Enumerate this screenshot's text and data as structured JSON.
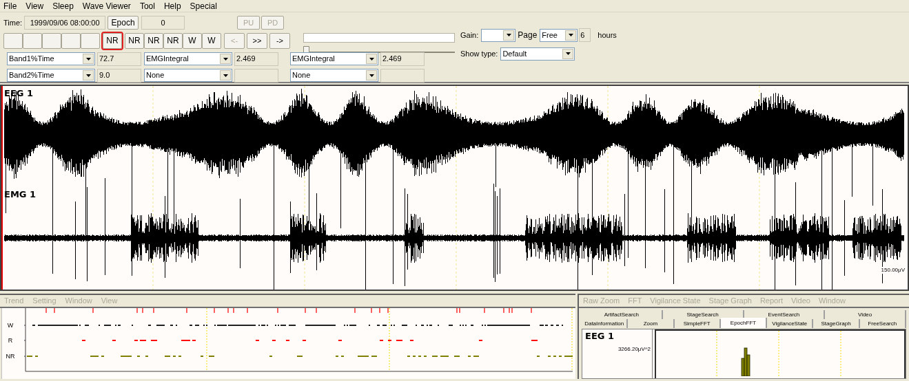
{
  "menu": [
    {
      "label": "File"
    },
    {
      "label": "View"
    },
    {
      "label": "Sleep"
    },
    {
      "label": "Wave Viewer"
    },
    {
      "label": "Tool"
    },
    {
      "label": "Help"
    },
    {
      "label": "Special"
    }
  ],
  "toolbar": {
    "time_label": "Time:",
    "time_value": "1999/09/06 08:00:00",
    "epoch_button": "Epoch",
    "epoch_value": "0",
    "page_buttons": [
      {
        "label": "PU",
        "disabled": true
      },
      {
        "label": "PD",
        "disabled": true
      }
    ],
    "stage_buttons": [
      {
        "kind": "blank",
        "selected": false
      },
      {
        "kind": "blank",
        "selected": false
      },
      {
        "kind": "blank",
        "selected": false
      },
      {
        "kind": "blank",
        "selected": false
      },
      {
        "kind": "blank",
        "selected": false
      },
      {
        "kind": "stage",
        "label": "NR",
        "selected": true
      },
      {
        "kind": "stage",
        "label": "NR",
        "selected": false
      },
      {
        "kind": "stage",
        "label": "NR",
        "selected": false
      },
      {
        "kind": "stage",
        "label": "NR",
        "selected": false
      },
      {
        "kind": "stage",
        "label": "W",
        "selected": false
      },
      {
        "kind": "stage",
        "label": "W",
        "selected": false
      }
    ],
    "nav_buttons": [
      {
        "label": "<-",
        "disabled": true
      },
      {
        "label": ">>",
        "disabled": false
      },
      {
        "label": "->",
        "disabled": false
      }
    ],
    "position_slider": {
      "level": 0
    },
    "gain_label": "Gain:",
    "page_label": "Page",
    "page_value": "Free",
    "hours_value": "6",
    "hours_label": "hours",
    "show_type_label": "Show type:",
    "show_type_value": "Default"
  },
  "measures": [
    [
      {
        "select": "Band1%Time",
        "value": "72.7"
      },
      {
        "select": "EMGIntegral",
        "value": "2.469"
      },
      {
        "select": "EMGIntegral",
        "value": "2.469"
      }
    ],
    [
      {
        "select": "Band2%Time",
        "value": "9.0"
      },
      {
        "select": "None"
      },
      {
        "select": "None"
      }
    ]
  ],
  "wave_viewer": {
    "channels": [
      {
        "name": "EEG 1"
      },
      {
        "name": "EMG 1",
        "scale": "150.00μV"
      }
    ]
  },
  "trend_panel": {
    "menu": [
      {
        "label": "Trend",
        "disabled": true
      },
      {
        "label": "Setting",
        "disabled": true
      },
      {
        "label": "Window",
        "disabled": true
      },
      {
        "label": "View",
        "disabled": true
      }
    ],
    "stages": [
      "W",
      "R",
      "NR"
    ]
  },
  "analysis_panel": {
    "menu": [
      {
        "label": "Raw Zoom",
        "disabled": true
      },
      {
        "label": "FFT",
        "disabled": true
      },
      {
        "label": "Vigilance State",
        "disabled": true
      },
      {
        "label": "Stage Graph",
        "disabled": true
      },
      {
        "label": "Report",
        "disabled": true
      },
      {
        "label": "Video",
        "disabled": true
      },
      {
        "label": "Window",
        "disabled": true
      }
    ],
    "tab_rows": [
      [
        {
          "label": "ArtifactSearch",
          "selected": false
        },
        {
          "label": "StageSearch",
          "selected": false
        },
        {
          "label": "EventSearch",
          "selected": false
        },
        {
          "label": "Video",
          "selected": false
        }
      ],
      [
        {
          "label": "DataInformation",
          "selected": false
        },
        {
          "label": "Zoom",
          "selected": false
        },
        {
          "label": "SimpleFFT",
          "selected": false
        },
        {
          "label": "EpochFFT",
          "selected": true
        },
        {
          "label": "VigilanceState",
          "selected": false
        },
        {
          "label": "StageGraph",
          "selected": false
        },
        {
          "label": "FreeSearch",
          "selected": false
        }
      ]
    ],
    "channel": "EEG 1",
    "y_max": "3266.20μV^2"
  }
}
